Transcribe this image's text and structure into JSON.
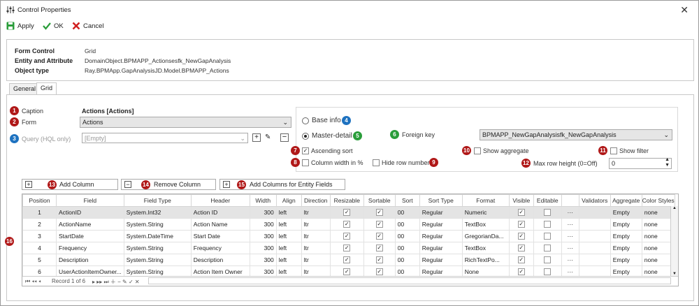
{
  "window": {
    "title": "Control Properties",
    "close": "✕"
  },
  "toolbar": {
    "apply": "Apply",
    "ok": "OK",
    "cancel": "Cancel"
  },
  "info": {
    "form_control_label": "Form Control",
    "form_control_value": "Grid",
    "entity_label": "Entity and Attribute",
    "entity_value": "DomainObject.BPMAPP_Actionsesfk_NewGapAnalysis",
    "type_label": "Object type",
    "type_value": "Ray.BPMApp.GapAnalysisJD.Model.BPMAPP_Actions"
  },
  "tabs": [
    "General",
    "Grid"
  ],
  "badges": [
    "1",
    "2",
    "3",
    "4",
    "5",
    "6",
    "7",
    "8",
    "9",
    "10",
    "11",
    "12",
    "13",
    "14",
    "15",
    "16"
  ],
  "left": {
    "caption_label": "Caption",
    "caption_value": "Actions [Actions]",
    "form_label": "Form",
    "form_value": "Actions",
    "query_label": "Query (HQL only)",
    "query_value": "[Empty]"
  },
  "right": {
    "base_info": "Base info",
    "master_detail": "Master-detail",
    "foreign_key_label": "Foreign key",
    "foreign_key_value": "BPMAPP_NewGapAnalysisfk_NewGapAnalysis",
    "ascending_sort": "Ascending sort",
    "show_aggregate": "Show aggregate",
    "show_filter": "Show filter",
    "column_width": "Column width in %",
    "hide_row_number": "Hide row number",
    "max_row_height_label": "Max row height (0=Off)",
    "max_row_height_value": "0"
  },
  "buttons": {
    "add_column": "Add Column",
    "remove_column": "Remove Column",
    "add_entity_fields": "Add Columns for Entity Fields"
  },
  "grid": {
    "headers": [
      "Position",
      "Field",
      "Field Type",
      "Header",
      "Width",
      "Align",
      "Direction",
      "Resizable",
      "Sortable",
      "Sort",
      "Sort Type",
      "Format",
      "Visible",
      "Editable",
      "",
      "Validators",
      "Aggregate",
      "Color Styles"
    ],
    "rows": [
      {
        "pos": "1",
        "field": "ActionID",
        "ftype": "System.Int32",
        "header": "Action ID",
        "width": "300",
        "align": "left",
        "dir": "ltr",
        "sort": "00",
        "stype": "Regular",
        "format": "Numeric",
        "more": "···",
        "agg": "Empty",
        "color": "none"
      },
      {
        "pos": "2",
        "field": "ActionName",
        "ftype": "System.String",
        "header": "Action Name",
        "width": "300",
        "align": "left",
        "dir": "ltr",
        "sort": "00",
        "stype": "Regular",
        "format": "TextBox",
        "more": "···",
        "agg": "Empty",
        "color": "none"
      },
      {
        "pos": "3",
        "field": "StartDate",
        "ftype": "System.DateTime",
        "header": "Start Date",
        "width": "300",
        "align": "left",
        "dir": "ltr",
        "sort": "00",
        "stype": "Regular",
        "format": "GregorianDa...",
        "more": "···",
        "agg": "Empty",
        "color": "none"
      },
      {
        "pos": "4",
        "field": "Frequency",
        "ftype": "System.String",
        "header": "Frequency",
        "width": "300",
        "align": "left",
        "dir": "ltr",
        "sort": "00",
        "stype": "Regular",
        "format": "TextBox",
        "more": "···",
        "agg": "Empty",
        "color": "none"
      },
      {
        "pos": "5",
        "field": "Description",
        "ftype": "System.String",
        "header": "Description",
        "width": "300",
        "align": "left",
        "dir": "ltr",
        "sort": "00",
        "stype": "Regular",
        "format": "RichTextPo...",
        "more": "···",
        "agg": "Empty",
        "color": "none"
      },
      {
        "pos": "6",
        "field": "UserActionItemOwner...",
        "ftype": "System.String",
        "header": "Action Item Owner",
        "width": "300",
        "align": "left",
        "dir": "ltr",
        "sort": "00",
        "stype": "Regular",
        "format": "None",
        "more": "···",
        "agg": "Empty",
        "color": "none"
      }
    ],
    "record_text": "Record 1 of 6"
  }
}
